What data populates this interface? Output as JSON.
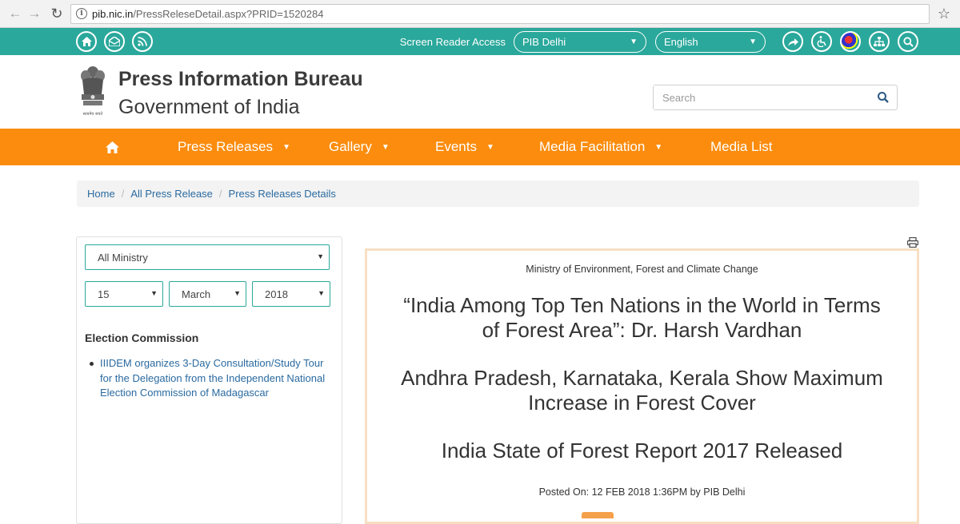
{
  "browser": {
    "url_host": "pib.nic.in",
    "url_path": "/PressReleseDetail.aspx?PRID=1520284"
  },
  "topbar": {
    "screen_reader_label": "Screen Reader Access",
    "region_select": "PIB Delhi",
    "language_select": "English",
    "icons_left": [
      "home-icon",
      "mail-icon",
      "rss-icon"
    ],
    "icons_right": [
      "share-icon",
      "accessibility-icon",
      "color-palette-icon",
      "sitemap-icon",
      "search-icon"
    ]
  },
  "header": {
    "org_name": "Press Information Bureau",
    "gov_name": "Government of India",
    "emblem_motto": "सत्यमेव जयते",
    "search_placeholder": "Search"
  },
  "nav": {
    "items": [
      {
        "label": "Press Releases",
        "has_dropdown": true
      },
      {
        "label": "Gallery",
        "has_dropdown": true
      },
      {
        "label": "Events",
        "has_dropdown": true
      },
      {
        "label": "Media Facilitation",
        "has_dropdown": true
      },
      {
        "label": "Media List",
        "has_dropdown": false
      }
    ]
  },
  "breadcrumb": [
    "Home",
    "All Press Release",
    "Press Releases Details"
  ],
  "filters": {
    "ministry": "All Ministry",
    "day": "15",
    "month": "March",
    "year": "2018"
  },
  "sidebar": {
    "section_title": "Election Commission",
    "items": [
      "IIIDEM organizes 3-Day Consultation/Study Tour for the Delegation from the Independent National Election Commission of Madagascar"
    ]
  },
  "article": {
    "ministry": "Ministry of Environment, Forest and Climate Change",
    "headline_1_line_1": "“India Among Top Ten Nations in the World in Terms",
    "headline_1_line_2": "of Forest Area”: Dr. Harsh Vardhan",
    "headline_2_line_1": "Andhra Pradesh, Karnataka, Kerala Show Maximum",
    "headline_2_line_2": "Increase in Forest Cover",
    "headline_3": "India State of Forest Report 2017 Released",
    "posted_on": "Posted On: 12 FEB 2018 1:36PM by PIB Delhi"
  },
  "colors": {
    "teal": "#2aa89b",
    "orange": "#fb8c0e",
    "link": "#2a6aa0",
    "article_border": "#f7dfc2"
  }
}
